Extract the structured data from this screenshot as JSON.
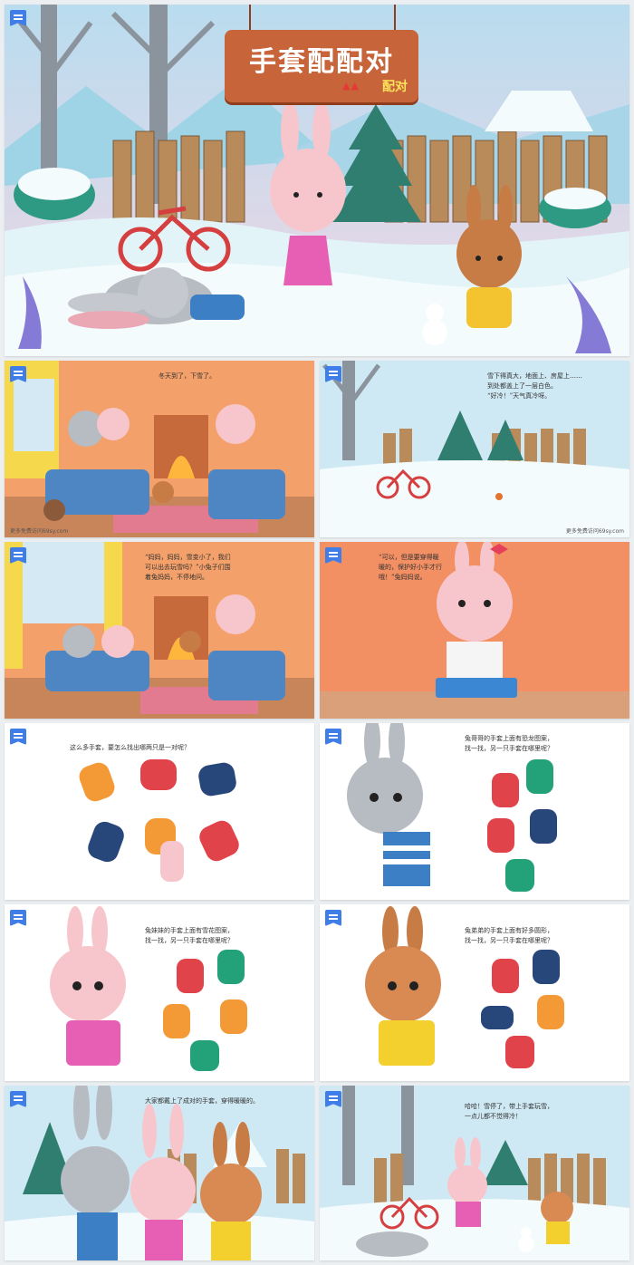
{
  "cover": {
    "title": "手套配配对",
    "subtitle": "配对",
    "level_marks": "▲▲"
  },
  "slides": [
    {
      "caption": "冬天到了，下雪了。",
      "watermark": "更多免费访问69sy.com"
    },
    {
      "caption": "雪下得真大，地面上、房屋上……\n到处都盖上了一层白色。\n“好冷！”天气真冷呀。",
      "watermark": "更多免费访问69sy.com"
    },
    {
      "caption": "“妈妈，妈妈，雪变小了，我们\n可以出去玩雪吗？”小兔子们围\n着兔妈妈，不停地问。",
      "watermark": ""
    },
    {
      "caption": "“可以，但是要穿得暖\n暖的，保护好小手才行\n哦！”兔妈妈说。",
      "watermark": ""
    },
    {
      "caption": "这么多手套，要怎么找出哪两只是一对呢？",
      "watermark": ""
    },
    {
      "caption": "兔哥哥的手套上面有恐龙图案，\n找一找，另一只手套在哪里呢？",
      "watermark": ""
    },
    {
      "caption": "兔妹妹的手套上面有雪花图案，\n找一找，另一只手套在哪里呢？",
      "watermark": ""
    },
    {
      "caption": "兔弟弟的手套上面有好多圆形，\n找一找，另一只手套在哪里呢？",
      "watermark": ""
    },
    {
      "caption": "大家都戴上了成对的手套，穿得暖暖的。",
      "watermark": ""
    },
    {
      "caption": "哈哈！雪停了，带上手套玩雪，\n一点儿都不觉得冷！",
      "watermark": ""
    }
  ],
  "colors": {
    "badge": "#3f7ee8",
    "sign": "#c7643a",
    "sky": "#cfe9f4",
    "snow": "#f4fbfd",
    "room_wall": "#f28f63",
    "mitten_red": "#e0434a",
    "mitten_green": "#23a27a",
    "mitten_orange": "#f39a36",
    "mitten_navy": "#27467a"
  }
}
